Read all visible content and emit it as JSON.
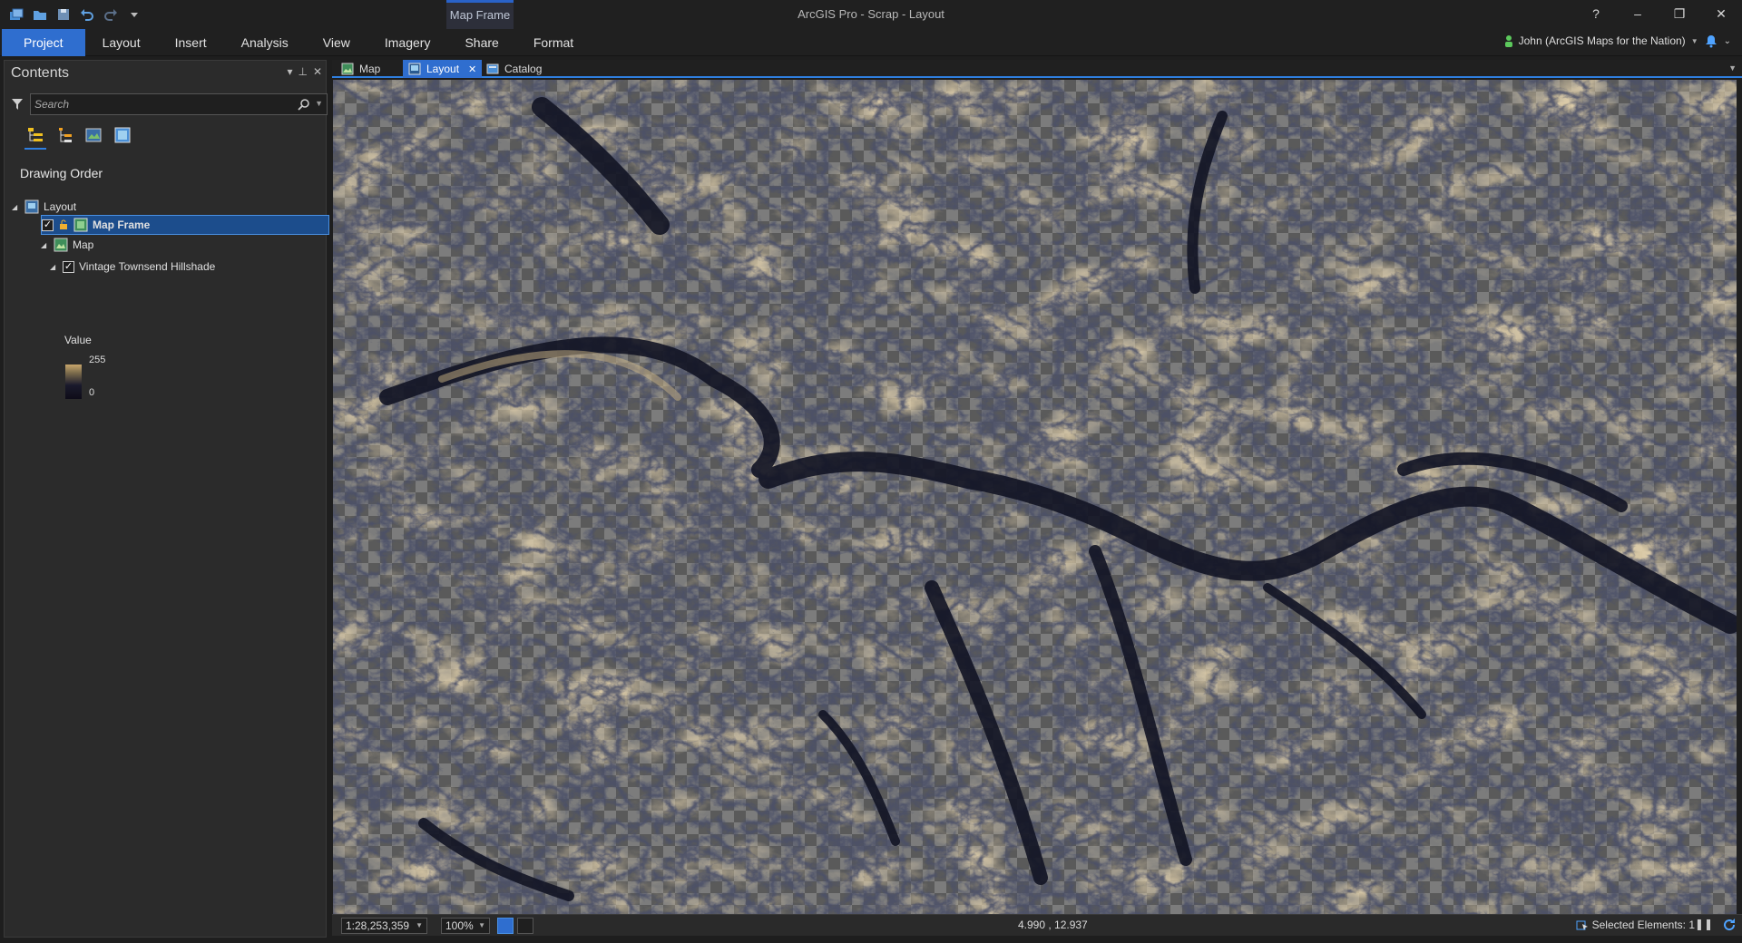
{
  "window": {
    "title": "ArcGIS Pro - Scrap - Layout",
    "context_tab": "Map Frame",
    "help": "?",
    "minimize": "–",
    "restore": "❐",
    "close": "✕"
  },
  "ribbon": {
    "tabs": [
      {
        "label": "Project"
      },
      {
        "label": "Layout"
      },
      {
        "label": "Insert"
      },
      {
        "label": "Analysis"
      },
      {
        "label": "View"
      },
      {
        "label": "Imagery"
      },
      {
        "label": "Share"
      },
      {
        "label": "Format"
      }
    ],
    "user": "John (ArcGIS Maps for the Nation)"
  },
  "contents": {
    "title": "Contents",
    "search_placeholder": "Search",
    "drawing_order": "Drawing Order",
    "tree": {
      "layout": "Layout",
      "map_frame": "Map Frame",
      "map": "Map",
      "layer": "Vintage Townsend Hillshade"
    },
    "legend": {
      "title": "Value",
      "high": "255",
      "low": "0"
    }
  },
  "view_tabs": [
    {
      "label": "Map"
    },
    {
      "label": "Layout"
    },
    {
      "label": "Catalog"
    }
  ],
  "status": {
    "scale": "1:28,253,359",
    "zoom": "100%",
    "coords": "4.990 , 12.937",
    "selected": "Selected Elements: 1"
  },
  "colors": {
    "accent": "#2f6ecf",
    "hillshade_light": "#c8a66c",
    "hillshade_dark": "#141625"
  }
}
